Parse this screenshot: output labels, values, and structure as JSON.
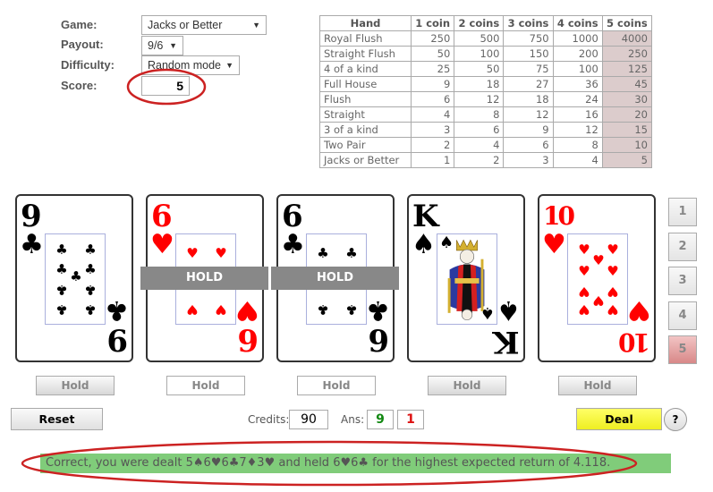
{
  "settings": {
    "game_label": "Game:",
    "game_value": "Jacks or Better",
    "payout_label": "Payout:",
    "payout_value": "9/6",
    "difficulty_label": "Difficulty:",
    "difficulty_value": "Random mode",
    "score_label": "Score:",
    "score_value": "5",
    "dropdown_arrow": "▼"
  },
  "paytable": {
    "headers": [
      "Hand",
      "1 coin",
      "2 coins",
      "3 coins",
      "4 coins",
      "5 coins"
    ],
    "rows": [
      [
        "Royal Flush",
        "250",
        "500",
        "750",
        "1000",
        "4000"
      ],
      [
        "Straight Flush",
        "50",
        "100",
        "150",
        "200",
        "250"
      ],
      [
        "4 of a kind",
        "25",
        "50",
        "75",
        "100",
        "125"
      ],
      [
        "Full House",
        "9",
        "18",
        "27",
        "36",
        "45"
      ],
      [
        "Flush",
        "6",
        "12",
        "18",
        "24",
        "30"
      ],
      [
        "Straight",
        "4",
        "8",
        "12",
        "16",
        "20"
      ],
      [
        "3 of a kind",
        "3",
        "6",
        "9",
        "12",
        "15"
      ],
      [
        "Two Pair",
        "2",
        "4",
        "6",
        "8",
        "10"
      ],
      [
        "Jacks or Better",
        "1",
        "2",
        "3",
        "4",
        "5"
      ]
    ],
    "highlight_color": "#dccccc"
  },
  "cards": [
    {
      "top_rank": "9",
      "bottom_rank": "6",
      "top_suit": "♣",
      "bottom_suit": "♣",
      "color": "black",
      "pips": 9,
      "pip_suit": "♣",
      "held": false
    },
    {
      "top_rank": "6",
      "bottom_rank": "9",
      "top_suit": "♥",
      "bottom_suit": "♥",
      "color": "red",
      "pips": 4,
      "pip_suit": "♥",
      "held": true
    },
    {
      "top_rank": "6",
      "bottom_rank": "9",
      "top_suit": "♣",
      "bottom_suit": "♣",
      "color": "black",
      "pips": 4,
      "pip_suit": "♣",
      "held": true
    },
    {
      "top_rank": "K",
      "bottom_rank": "K",
      "top_suit": "♠",
      "bottom_suit": "♠",
      "color": "black",
      "face": "king",
      "held": false
    },
    {
      "top_rank": "10",
      "bottom_rank": "10",
      "top_suit": "♥",
      "bottom_suit": "♥",
      "color": "red",
      "pips": 10,
      "pip_suit": "♥",
      "held": false
    }
  ],
  "hold_overlay_label": "HOLD",
  "hold_button_label": "Hold",
  "hold_buttons_state": [
    false,
    true,
    true,
    false,
    false
  ],
  "side_buttons": [
    "1",
    "2",
    "3",
    "4",
    "5"
  ],
  "side_active": "5",
  "controls": {
    "reset_label": "Reset",
    "credits_label": "Credits:",
    "credits_value": "90",
    "ans_label": "Ans:",
    "ans_correct": "9",
    "ans_wrong": "1",
    "deal_label": "Deal",
    "help_label": "?"
  },
  "message": "Correct, you were dealt 5♠6♥6♣7♦3♥ and held 6♥6♣ for the highest expected return of 4.118.",
  "colors": {
    "message_bg": "#80cc7a",
    "deal_bg": "#eeee33",
    "annotation_red": "#cc2222",
    "ans_correct": "#118811",
    "ans_wrong": "#dd1111"
  }
}
